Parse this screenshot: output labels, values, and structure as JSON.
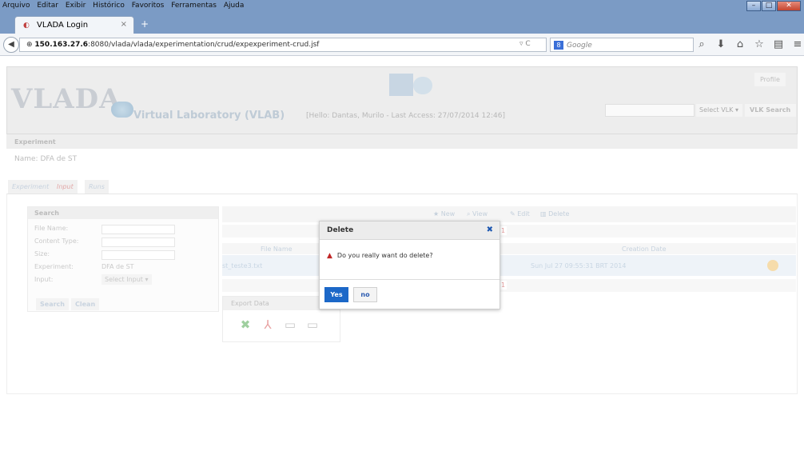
{
  "browser": {
    "menu": [
      "Arquivo",
      "Editar",
      "Exibir",
      "Histórico",
      "Favoritos",
      "Ferramentas",
      "Ajuda"
    ],
    "tab_title": "VLADA Login",
    "tab_close": "×",
    "new_tab": "+",
    "url_host": "150.163.27.6",
    "url_rest": ":8080/vlada/vlada/experimentation/crud/expexperiment-crud.jsf",
    "search_placeholder": "Google",
    "search_engine_badge": "8"
  },
  "header": {
    "logo": "VLADA",
    "title": "Virtual Laboratory (VLAB)",
    "subtitle": "[Hello: Dantas, Murilo - Last Access: 27/07/2014 12:46]",
    "profile": "Profile",
    "vlk_select": "Select VLK",
    "vlk_search": "VLK Search"
  },
  "experiment": {
    "section": "Experiment",
    "name_line": "Name: DFA de ST"
  },
  "tabs": [
    "Experiment",
    "Input",
    "Runs"
  ],
  "search": {
    "title": "Search",
    "fields": {
      "file_name": "File Name:",
      "content_type": "Content Type:",
      "size": "Size:",
      "experiment": "Experiment:",
      "experiment_value": "DFA de ST",
      "input": "Input:",
      "input_value": "Select Input"
    },
    "search_btn": "Search",
    "clean_btn": "Clean"
  },
  "toolbar": {
    "new": "New",
    "view": "View",
    "edit": "Edit",
    "delete": "Delete"
  },
  "table": {
    "page": "1",
    "headers": [
      "File Name",
      "Creation Date"
    ],
    "rows": [
      {
        "file_name": "st_teste3.txt",
        "creation_date": "Sun Jul 27 09:55:31 BRT 2014"
      }
    ]
  },
  "export": {
    "title": "Export Data"
  },
  "modal": {
    "title": "Delete",
    "message": "Do you really want do delete?",
    "yes": "Yes",
    "no": "no"
  }
}
